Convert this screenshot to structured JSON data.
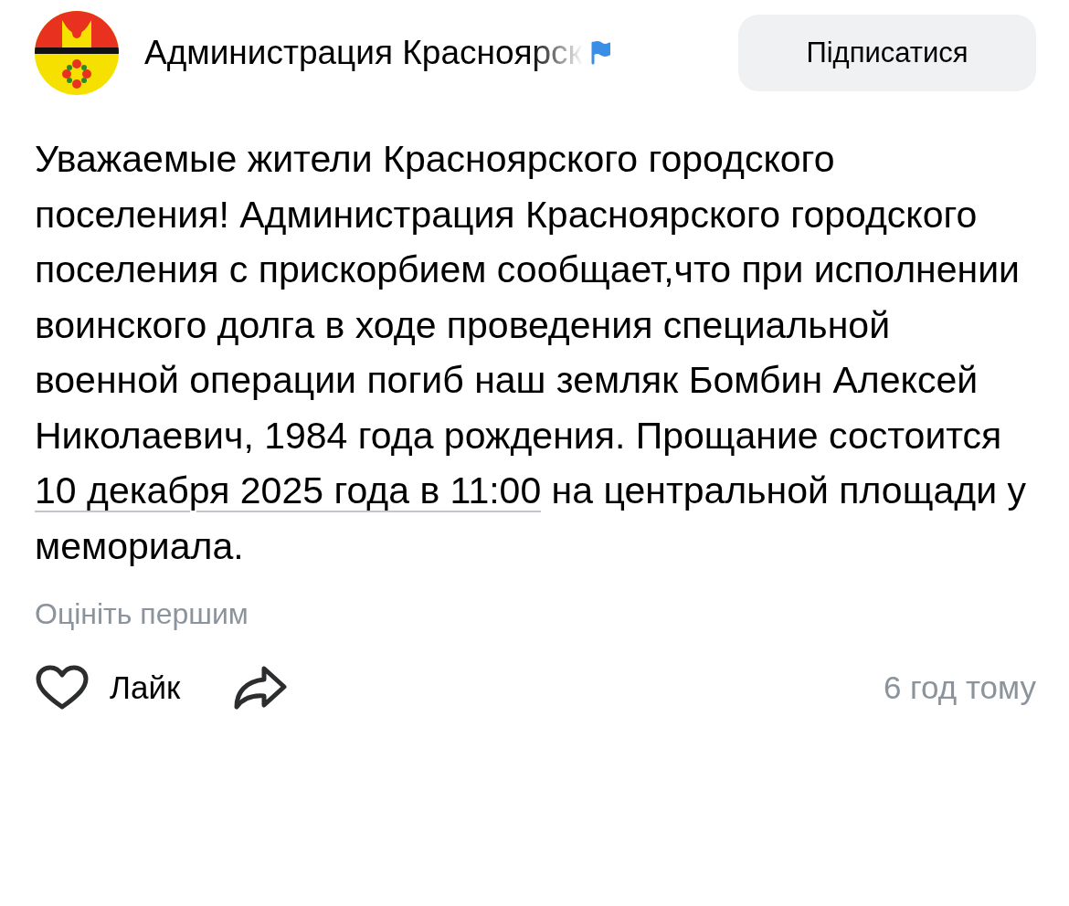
{
  "author": {
    "name": "Администрация Красноярск",
    "verified": true
  },
  "subscribe_button": "Підписатися",
  "post": {
    "text_before": "Уважаемые жители Красноярского городского поселения! Администрация Красноярского городского поселения с прискорбием сообщает,что при исполнении воинского долга в ходе проведения специальной военной операции погиб наш земляк Бомбин Алексей Николаевич, 1984 года рождения. Прощание состоится ",
    "link": "10 декабря 2025 года в 11:00",
    "text_after": " на центральной площади у мемориала."
  },
  "rate_prompt": "Оцініть першим",
  "actions": {
    "like": {
      "label": "Лайк",
      "liked": false
    },
    "time": "6 год тому"
  }
}
